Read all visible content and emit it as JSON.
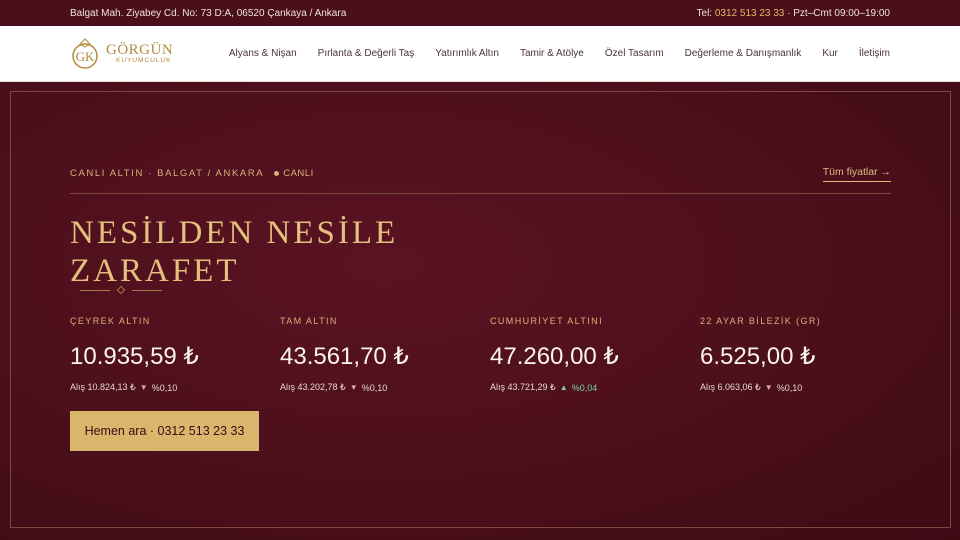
{
  "topbar": {
    "address": "Balgat Mah. Ziyabey Cd. No: 73 D:A, 06520 Çankaya / Ankara",
    "tel_label": "Tel:",
    "tel": "0312 513 23 33",
    "hours": "· Pzt–Cmt 09:00–19:00"
  },
  "logo": {
    "monogram": "GK",
    "name": "GÖRGÜN",
    "sub": "KUYUMCULUK"
  },
  "nav": {
    "items": [
      "Alyans & Nişan",
      "Pırlanta & Değerli Taş",
      "Yatırımlık Altın",
      "Tamir & Atölye",
      "Özel Tasarım",
      "Değerleme & Danışmanlık",
      "Kur",
      "İletişim"
    ]
  },
  "hero": {
    "eyebrow": "CANLI ALTIN · BALGAT / ANKARA",
    "live_label": "CANLI",
    "all_prices": "Tüm fiyatlar →",
    "headline_line1": "NESİLDEN NESİLE",
    "headline_line2": "ZARAFET",
    "prices": [
      {
        "name": "ÇEYREK ALTIN",
        "value": "10.935,59 ₺",
        "buy": "Alış 10.824,13 ₺",
        "dir": "▼",
        "change": "%0,10"
      },
      {
        "name": "TAM ALTIN",
        "value": "43.561,70 ₺",
        "buy": "Alış 43.202,78 ₺",
        "dir": "▼",
        "change": "%0,10"
      },
      {
        "name": "CUMHURİYET ALTINI",
        "value": "47.260,00 ₺",
        "buy": "Alış 43.721,29 ₺",
        "dir": "▲",
        "change": "%0,04"
      },
      {
        "name": "22 AYAR BİLEZİK (GR)",
        "value": "6.525,00 ₺",
        "buy": "Alış 6.063,06 ₺",
        "dir": "▼",
        "change": "%0,10"
      }
    ],
    "cta": "Hemen ara · 0312 513 23 33"
  },
  "colors": {
    "background": "#4a0f1a",
    "gold": "#d8b66c",
    "up": "#7fd6a2"
  }
}
